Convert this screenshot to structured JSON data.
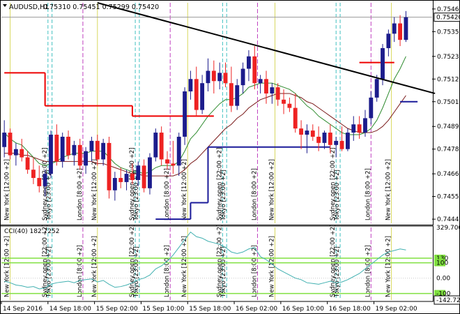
{
  "header": {
    "symbol": "AUDUSD,H1",
    "ohlc": "0.75310 0.75451 0.75299 0.75420"
  },
  "colors": {
    "bull": "#1c1c8c",
    "bear": "#ee2222",
    "ma_fast": "#2e8b2e",
    "ma_slow": "#7a1a1a",
    "sar_red": "#ee0000",
    "sar_blue": "#1a1a99",
    "trendline": "#000000",
    "session_london": "#c040c0",
    "session_ny": "#d8d860",
    "session_sydney": "#40c0c0",
    "cci_line": "#40b0b0",
    "cci_level": "#80e040"
  },
  "chart_data": [
    {
      "type": "candlestick",
      "title": "AUDUSD,H1",
      "price_labels": [
        "0.75460",
        "0.75350",
        "0.75230",
        "0.75120",
        "0.75010",
        "0.74890",
        "0.74780",
        "0.74660",
        "0.74550",
        "0.74440"
      ],
      "price_ticks": [
        0.7546,
        0.7535,
        0.7523,
        0.7512,
        0.7501,
        0.7489,
        0.7478,
        0.7466,
        0.7455,
        0.7444
      ],
      "ylim": [
        0.7442,
        0.7549
      ],
      "current_price_label": "0.75420",
      "current_price": 0.7542,
      "time_labels": [
        "14 Sep 2016",
        "14 Sep 18:00",
        "15 Sep 02:00",
        "15 Sep 10:00",
        "15 Sep 18:00",
        "16 Sep 02:00",
        "16 Sep 10:00",
        "16 Sep 18:00",
        "19 Sep 02:00"
      ],
      "time_label_bars": [
        0,
        8,
        16,
        24,
        32,
        40,
        48,
        56,
        64
      ],
      "n_bars": 74,
      "candles": [
        [
          0.7479,
          0.7492,
          0.7474,
          0.7486
        ],
        [
          0.7486,
          0.7488,
          0.7473,
          0.7475
        ],
        [
          0.7475,
          0.7481,
          0.747,
          0.7478
        ],
        [
          0.7478,
          0.7483,
          0.7472,
          0.7474
        ],
        [
          0.7474,
          0.7477,
          0.7466,
          0.7468
        ],
        [
          0.7468,
          0.7474,
          0.7461,
          0.7464
        ],
        [
          0.7464,
          0.747,
          0.7457,
          0.746
        ],
        [
          0.746,
          0.7468,
          0.7455,
          0.7466
        ],
        [
          0.7466,
          0.7487,
          0.7464,
          0.7485
        ],
        [
          0.7485,
          0.749,
          0.747,
          0.7472
        ],
        [
          0.7472,
          0.7486,
          0.7469,
          0.7484
        ],
        [
          0.7484,
          0.7487,
          0.7473,
          0.7475
        ],
        [
          0.7475,
          0.7482,
          0.747,
          0.748
        ],
        [
          0.748,
          0.7483,
          0.7468,
          0.747
        ],
        [
          0.747,
          0.7479,
          0.7466,
          0.7477
        ],
        [
          0.7477,
          0.7484,
          0.7472,
          0.7482
        ],
        [
          0.7482,
          0.7485,
          0.747,
          0.7473
        ],
        [
          0.7473,
          0.7483,
          0.747,
          0.7481
        ],
        [
          0.7481,
          0.7484,
          0.7454,
          0.7458
        ],
        [
          0.7458,
          0.7467,
          0.7453,
          0.7464
        ],
        [
          0.7464,
          0.7469,
          0.7459,
          0.7462
        ],
        [
          0.7462,
          0.7468,
          0.7458,
          0.7466
        ],
        [
          0.7466,
          0.7471,
          0.7461,
          0.7463
        ],
        [
          0.7463,
          0.7472,
          0.746,
          0.747
        ],
        [
          0.747,
          0.7473,
          0.7457,
          0.7459
        ],
        [
          0.7459,
          0.7476,
          0.7456,
          0.7474
        ],
        [
          0.7474,
          0.7488,
          0.7472,
          0.7486
        ],
        [
          0.7486,
          0.7489,
          0.747,
          0.7473
        ],
        [
          0.7473,
          0.7477,
          0.7468,
          0.7471
        ],
        [
          0.7471,
          0.7482,
          0.7466,
          0.747
        ],
        [
          0.747,
          0.7486,
          0.7465,
          0.7484
        ],
        [
          0.7484,
          0.7508,
          0.748,
          0.7506
        ],
        [
          0.7506,
          0.7516,
          0.7502,
          0.7512
        ],
        [
          0.7512,
          0.7518,
          0.7494,
          0.7497
        ],
        [
          0.7497,
          0.7514,
          0.7495,
          0.751
        ],
        [
          0.751,
          0.7522,
          0.7506,
          0.7516
        ],
        [
          0.7516,
          0.7521,
          0.7505,
          0.7511
        ],
        [
          0.7511,
          0.752,
          0.7507,
          0.7515
        ],
        [
          0.7515,
          0.752,
          0.7508,
          0.751
        ],
        [
          0.751,
          0.7518,
          0.7496,
          0.7499
        ],
        [
          0.7499,
          0.7512,
          0.7497,
          0.7509
        ],
        [
          0.7509,
          0.752,
          0.7505,
          0.7517
        ],
        [
          0.7517,
          0.7526,
          0.7511,
          0.7523
        ],
        [
          0.7523,
          0.7528,
          0.7507,
          0.751
        ],
        [
          0.751,
          0.7514,
          0.7505,
          0.7512
        ],
        [
          0.7512,
          0.7516,
          0.75,
          0.7505
        ],
        [
          0.7505,
          0.751,
          0.75,
          0.7508
        ],
        [
          0.7508,
          0.751,
          0.7499,
          0.7502
        ],
        [
          0.7502,
          0.7507,
          0.7495,
          0.75
        ],
        [
          0.75,
          0.7503,
          0.7496,
          0.7498
        ],
        [
          0.7498,
          0.7505,
          0.7486,
          0.7488
        ],
        [
          0.7488,
          0.7492,
          0.7478,
          0.7485
        ],
        [
          0.7485,
          0.749,
          0.7476,
          0.7487
        ],
        [
          0.7487,
          0.749,
          0.7482,
          0.7484
        ],
        [
          0.7484,
          0.7489,
          0.7477,
          0.7481
        ],
        [
          0.7481,
          0.7487,
          0.7478,
          0.7486
        ],
        [
          0.7486,
          0.749,
          0.7476,
          0.748
        ],
        [
          0.748,
          0.7484,
          0.7474,
          0.7482
        ],
        [
          0.7482,
          0.7489,
          0.7477,
          0.7478
        ],
        [
          0.7478,
          0.7488,
          0.7477,
          0.7486
        ],
        [
          0.7486,
          0.7494,
          0.7482,
          0.749
        ],
        [
          0.749,
          0.7494,
          0.7483,
          0.7486
        ],
        [
          0.7486,
          0.7497,
          0.7484,
          0.7493
        ],
        [
          0.7493,
          0.7506,
          0.749,
          0.7503
        ],
        [
          0.7503,
          0.7514,
          0.7501,
          0.7512
        ],
        [
          0.7512,
          0.7529,
          0.7509,
          0.7527
        ],
        [
          0.7527,
          0.7536,
          0.7523,
          0.7534
        ],
        [
          0.7534,
          0.7542,
          0.753,
          0.7539
        ],
        [
          0.7539,
          0.7543,
          0.7528,
          0.7531
        ],
        [
          0.7531,
          0.7545,
          0.753,
          0.7542
        ]
      ],
      "ma_fast": [
        0.7486,
        0.7483,
        0.7481,
        0.748,
        0.7477,
        0.7474,
        0.7471,
        0.747,
        0.7471,
        0.7472,
        0.7474,
        0.7475,
        0.7476,
        0.7476,
        0.7476,
        0.7477,
        0.7477,
        0.7477,
        0.7474,
        0.7471,
        0.7469,
        0.7468,
        0.7467,
        0.7467,
        0.7466,
        0.7467,
        0.7469,
        0.747,
        0.747,
        0.747,
        0.7472,
        0.7477,
        0.7483,
        0.7486,
        0.749,
        0.7494,
        0.7497,
        0.75,
        0.7502,
        0.7502,
        0.7503,
        0.7505,
        0.7508,
        0.7509,
        0.751,
        0.751,
        0.751,
        0.7509,
        0.7508,
        0.7507,
        0.7505,
        0.7502,
        0.7499,
        0.7497,
        0.7494,
        0.7492,
        0.749,
        0.7488,
        0.7486,
        0.7485,
        0.7485,
        0.7485,
        0.7486,
        0.7488,
        0.7492,
        0.7498,
        0.7505,
        0.7512,
        0.7517,
        0.7523
      ],
      "ma_slow": [
        0.7476,
        0.7476,
        0.7476,
        0.7475,
        0.7475,
        0.7474,
        0.7473,
        0.7472,
        0.7472,
        0.7472,
        0.7472,
        0.7472,
        0.7472,
        0.7472,
        0.7472,
        0.7472,
        0.7471,
        0.7471,
        0.747,
        0.7469,
        0.7468,
        0.7467,
        0.7466,
        0.7466,
        0.7465,
        0.7465,
        0.7465,
        0.7465,
        0.7465,
        0.7465,
        0.7466,
        0.7468,
        0.7471,
        0.7473,
        0.7476,
        0.7479,
        0.7482,
        0.7485,
        0.7488,
        0.749,
        0.7493,
        0.7495,
        0.7498,
        0.75,
        0.7502,
        0.7503,
        0.7504,
        0.7505,
        0.7505,
        0.7505,
        0.7504,
        0.7503,
        0.7501,
        0.75,
        0.7498,
        0.7496,
        0.7494,
        0.7492,
        0.749,
        0.7488,
        0.7487,
        0.7486,
        0.7486,
        0.7486,
        0.7487,
        0.7489,
        0.7492,
        0.7496,
        0.75,
        0.7504
      ],
      "sar_red": [
        {
          "from": 0,
          "to": 7,
          "y": 0.7515
        },
        {
          "from": 7,
          "to": 22,
          "y": 0.7499
        },
        {
          "from": 22,
          "to": 36,
          "y": 0.7494
        },
        {
          "from": 61,
          "to": 67,
          "y": 0.752
        }
      ],
      "sar_blue": [
        {
          "from": 26,
          "to": 32,
          "y": 0.7444
        },
        {
          "from": 32,
          "to": 35,
          "y": 0.7452
        },
        {
          "from": 35,
          "to": 56,
          "y": 0.7479
        },
        {
          "from": 68,
          "to": 71,
          "y": 0.7501
        }
      ],
      "trendline": [
        {
          "bar": 16,
          "price": 0.7549
        },
        {
          "bar": 74,
          "price": 0.7505
        }
      ],
      "session_bars": [
        {
          "bar": 1.0,
          "kind": "ny"
        },
        {
          "bar": 7.5,
          "kind": "sydney"
        },
        {
          "bar": 8.2,
          "kind": "tokyo"
        },
        {
          "bar": 13.5,
          "kind": "london"
        },
        {
          "bar": 16.0,
          "kind": "ny"
        },
        {
          "bar": 22.5,
          "kind": "sydney"
        },
        {
          "bar": 23.2,
          "kind": "tokyo"
        },
        {
          "bar": 28.5,
          "kind": "london"
        },
        {
          "bar": 31.5,
          "kind": "ny"
        },
        {
          "bar": 37.5,
          "kind": "sydney"
        },
        {
          "bar": 38.2,
          "kind": "tokyo"
        },
        {
          "bar": 43.5,
          "kind": "london"
        },
        {
          "bar": 46.5,
          "kind": "ny"
        },
        {
          "bar": 57.0,
          "kind": "sydney"
        },
        {
          "bar": 57.7,
          "kind": "tokyo"
        },
        {
          "bar": 63.0,
          "kind": "london"
        },
        {
          "bar": 66.5,
          "kind": "ny"
        }
      ],
      "vertical_labels": [
        "New York  [12:00 +2]",
        "Sydney open  [22:00 +2]",
        "Tokyo  [23:00 +2]",
        "London  [8:00 +2]",
        "New York  [12:00 +2]",
        "Sydney open  [22:00 +2]",
        "Tokyo  [23:00 +2]",
        "London  [8:00 +2]",
        "New York  [12:00 +2]",
        "Sydney open  [22:00 +2]",
        "Tokyo  [23:00 +2]",
        "London  [8:00 +2]",
        "New York  [12:00 +2]",
        "Sydney open  [22:00 +2]",
        "Tokyo  [23:00 +2]",
        "London  [8:00 +2]",
        "New York  [12:00 +2]"
      ]
    },
    {
      "type": "line",
      "title": "CCI(40) 182.7252",
      "name": "CCI(40)",
      "current_value": 182.7252,
      "ylim": [
        -142.7242,
        329.7003
      ],
      "tick_labels": [
        "329.7003",
        "130",
        "100",
        "0.00",
        "-100",
        "-142.7242"
      ],
      "tick_values": [
        329.7003,
        130,
        100,
        0,
        -100,
        -142.7242
      ],
      "levels": [
        130,
        100,
        -100
      ],
      "values": [
        -20,
        -30,
        -45,
        -50,
        -60,
        -55,
        -70,
        -65,
        -40,
        -30,
        -25,
        -20,
        -30,
        -15,
        -10,
        -5,
        -25,
        -15,
        -40,
        -60,
        -55,
        -45,
        -30,
        -10,
        0,
        20,
        60,
        80,
        110,
        150,
        200,
        250,
        300,
        270,
        260,
        240,
        230,
        220,
        200,
        170,
        160,
        170,
        190,
        200,
        140,
        120,
        90,
        60,
        40,
        20,
        0,
        -10,
        -30,
        -35,
        -40,
        -30,
        -20,
        -30,
        -25,
        -10,
        10,
        30,
        60,
        90,
        120,
        150,
        170,
        180,
        190,
        183
      ]
    }
  ]
}
